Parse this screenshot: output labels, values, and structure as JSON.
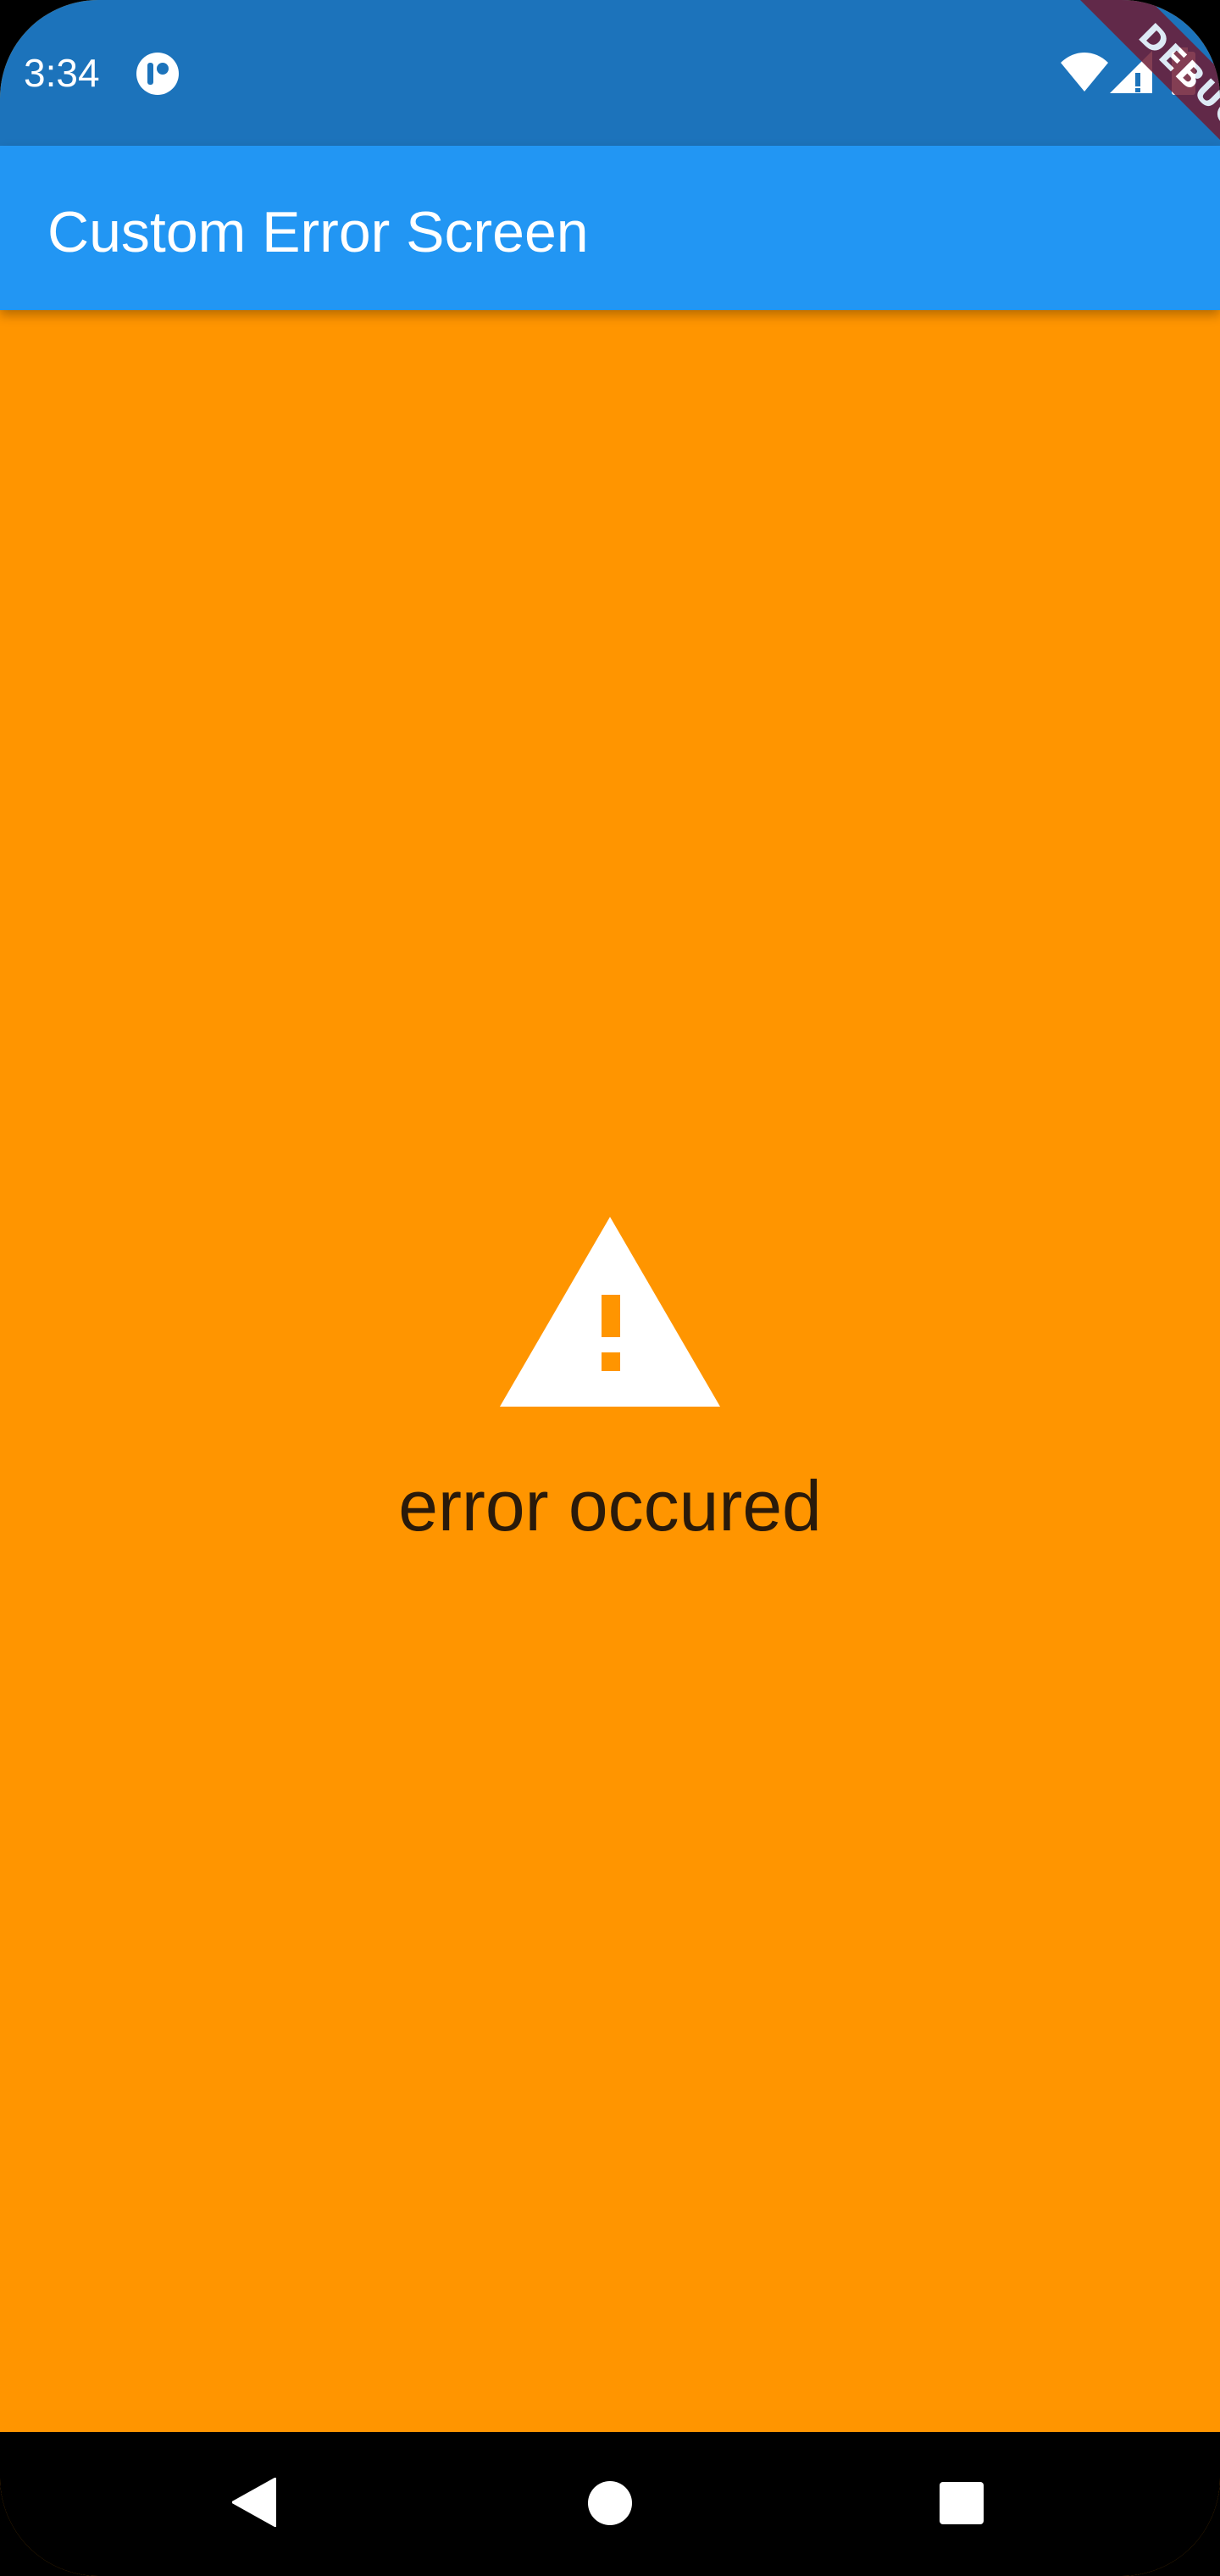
{
  "status_bar": {
    "time": "3:34",
    "icons": [
      "notification-app-icon",
      "wifi-icon",
      "signal-icon",
      "battery-icon"
    ]
  },
  "debug_banner": {
    "label": "DEBUG"
  },
  "app_bar": {
    "title": "Custom Error Screen"
  },
  "body": {
    "icon": "warning-icon",
    "message": "error occured"
  },
  "nav_bar": {
    "icons": [
      "back-icon",
      "home-icon",
      "recents-icon"
    ]
  },
  "colors": {
    "status_bar": "#1C73BB",
    "app_bar": "#2296F3",
    "background": "#FF9500",
    "debug_ribbon": "#6E1D35",
    "message_text": "#2A1A0A",
    "nav_bar": "#000000"
  }
}
